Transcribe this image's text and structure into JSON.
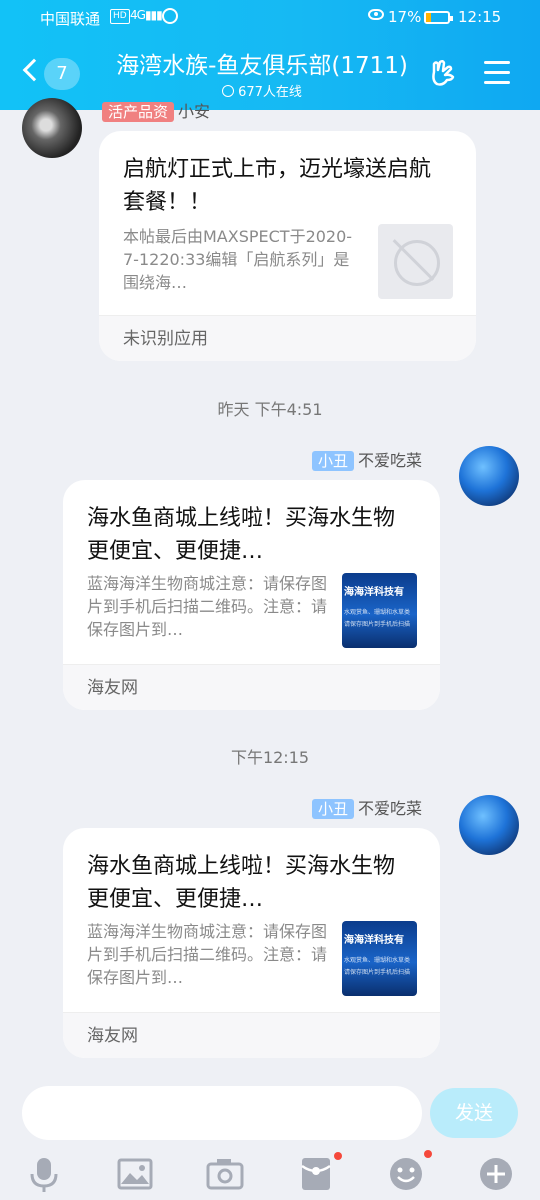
{
  "status_bar": {
    "carrier": "中国联通",
    "hd": "HD",
    "signal": "4G",
    "eye_battery": "17%",
    "time": "12:15"
  },
  "header": {
    "back_count": "7",
    "title": "海湾水族-鱼友俱乐部(1711)",
    "online": "677人在线"
  },
  "messages": [
    {
      "sender_badge": "活产品资",
      "sender_name": "小安",
      "card_title": "启航灯正式上市，迈光壕送启航套餐！！",
      "card_desc": "本帖最后由MAXSPECT于2020-7-1220:33编辑「启航系列」是围绕海…",
      "card_source": "未识别应用"
    },
    {
      "time": "昨天 下午4:51",
      "sender_badge": "小丑",
      "sender_name": "不爱吃菜",
      "card_title": "海水鱼商城上线啦！买海水生物更便宜、更便捷…",
      "card_desc": "蓝海海洋生物商城注意：请保存图片到手机后扫描二维码。注意：请保存图片到…",
      "card_source": "海友网",
      "thumb_text": "海海洋科技有",
      "thumb_sub1": "水观赏鱼、珊瑚和水草类",
      "thumb_sub2": "请保存图片到手机后扫描"
    },
    {
      "time": "下午12:15",
      "sender_badge": "小丑",
      "sender_name": "不爱吃菜",
      "card_title": "海水鱼商城上线啦！买海水生物更便宜、更便捷…",
      "card_desc": "蓝海海洋生物商城注意：请保存图片到手机后扫描二维码。注意：请保存图片到…",
      "card_source": "海友网",
      "thumb_text": "海海洋科技有",
      "thumb_sub1": "水观赏鱼、珊瑚和水草类",
      "thumb_sub2": "请保存图片到手机后扫描"
    }
  ],
  "composer": {
    "input_value": "",
    "send_label": "发送"
  },
  "colors": {
    "header_gradient_start": "#12c2f7",
    "header_gradient_end": "#0fa8f2",
    "badge_blue": "#8ec4ff",
    "notification_dot": "#f5483b"
  }
}
